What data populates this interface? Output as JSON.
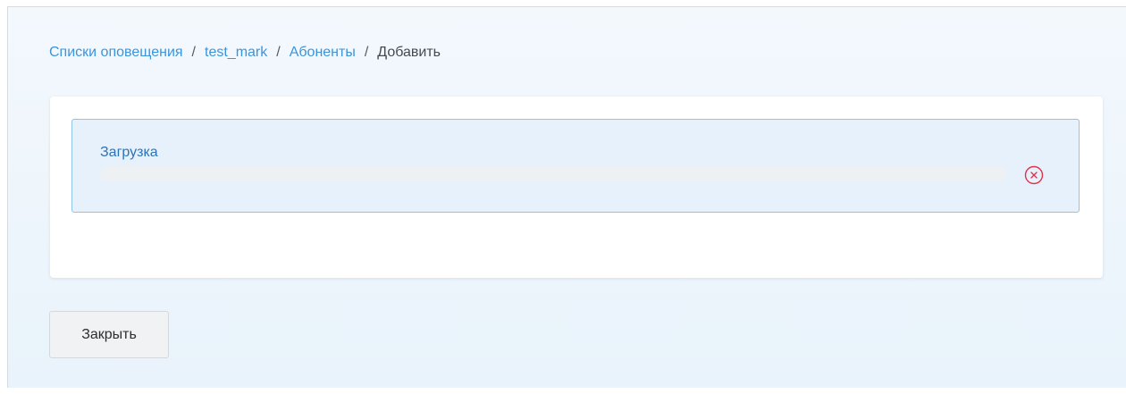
{
  "breadcrumb": {
    "items": [
      {
        "label": "Списки оповещения",
        "link": true
      },
      {
        "label": "test_mark",
        "link": true
      },
      {
        "label": "Абоненты",
        "link": true
      },
      {
        "label": "Добавить",
        "link": false
      }
    ],
    "separator": "/"
  },
  "upload": {
    "label": "Загрузка",
    "progress": 0,
    "cancel_icon": "close-circle-icon"
  },
  "footer": {
    "close_label": "Закрыть"
  },
  "colors": {
    "link": "#3d94d9",
    "upload_border": "#8ec3ea",
    "upload_bg": "#e6f1fb",
    "cancel": "#e0344b"
  }
}
